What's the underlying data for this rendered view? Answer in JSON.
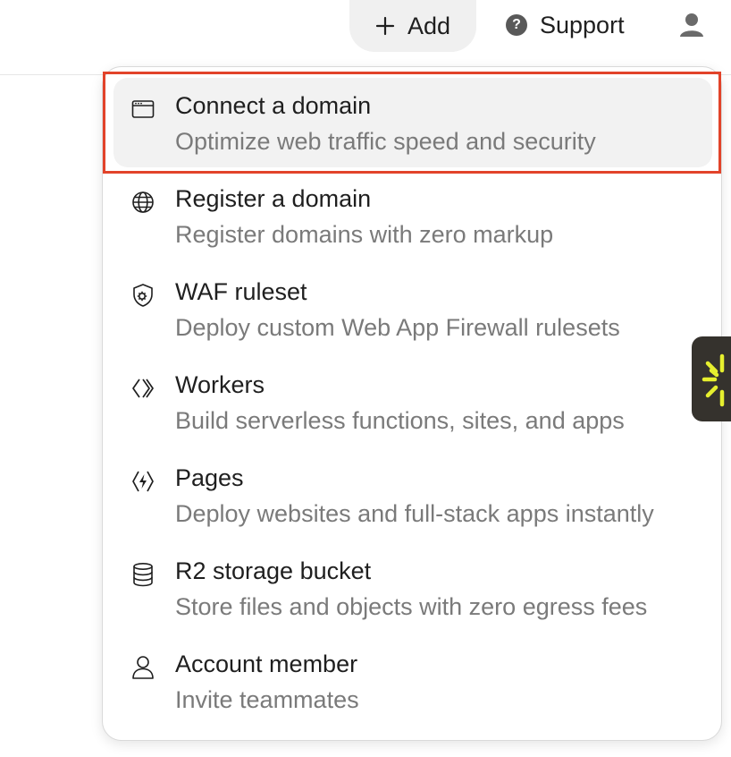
{
  "header": {
    "add_label": "Add",
    "support_label": "Support",
    "support_glyph": "?"
  },
  "menu": {
    "items": [
      {
        "title": "Connect a domain",
        "desc": "Optimize web traffic speed and security",
        "icon": "browser-window-icon",
        "active": true
      },
      {
        "title": "Register a domain",
        "desc": "Register domains with zero markup",
        "icon": "globe-icon"
      },
      {
        "title": "WAF ruleset",
        "desc": "Deploy custom Web App Firewall rulesets",
        "icon": "shield-gear-icon"
      },
      {
        "title": "Workers",
        "desc": "Build serverless functions, sites, and apps",
        "icon": "workers-icon"
      },
      {
        "title": "Pages",
        "desc": "Deploy websites and full-stack apps instantly",
        "icon": "pages-icon"
      },
      {
        "title": "R2 storage bucket",
        "desc": "Store files and objects with zero egress fees",
        "icon": "database-icon"
      },
      {
        "title": "Account member",
        "desc": "Invite teammates",
        "icon": "user-icon"
      }
    ]
  },
  "colors": {
    "highlight_border": "#e2432a",
    "active_item_bg": "#f2f2f2",
    "widget_bg": "#35322d",
    "widget_accent": "#e6ef2e"
  }
}
